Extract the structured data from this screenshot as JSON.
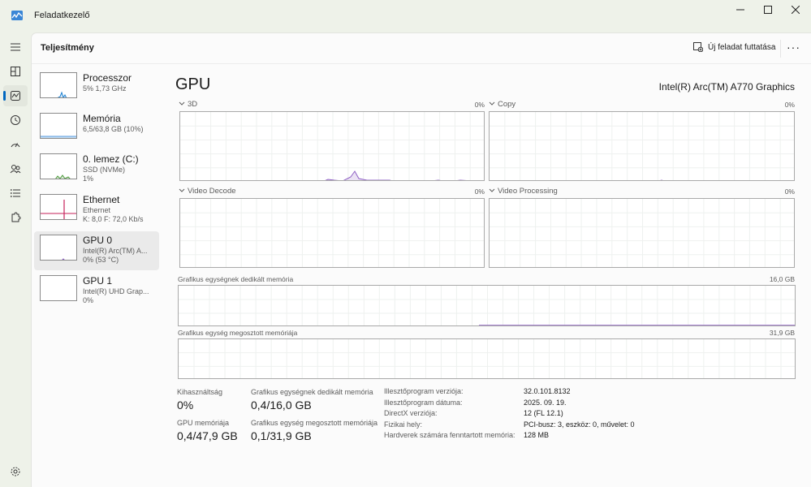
{
  "window": {
    "title": "Feladatkezelő"
  },
  "header": {
    "title": "Teljesítmény",
    "run_new_task": "Új feladat futtatása",
    "more": "···"
  },
  "devices": [
    {
      "name": "Processzor",
      "sub1": "5%  1,73 GHz",
      "sub2": ""
    },
    {
      "name": "Memória",
      "sub1": "6,5/63,8 GB (10%)",
      "sub2": ""
    },
    {
      "name": "0. lemez (C:)",
      "sub1": "SSD (NVMe)",
      "sub2": "1%"
    },
    {
      "name": "Ethernet",
      "sub1": "Ethernet",
      "sub2": "K: 8,0  F: 72,0 Kb/s"
    },
    {
      "name": "GPU 0",
      "sub1": "Intel(R) Arc(TM) A...",
      "sub2": "0%  (53 °C)"
    },
    {
      "name": "GPU 1",
      "sub1": "Intel(R) UHD Grap...",
      "sub2": "0%"
    }
  ],
  "detail": {
    "title": "GPU",
    "model": "Intel(R) Arc(TM) A770 Graphics",
    "engines": [
      {
        "name": "3D",
        "percent": "0%"
      },
      {
        "name": "Copy",
        "percent": "0%"
      },
      {
        "name": "Video Decode",
        "percent": "0%"
      },
      {
        "name": "Video Processing",
        "percent": "0%"
      }
    ],
    "dedicated_memory": {
      "label": "Grafikus egységnek dedikált memória",
      "max": "16,0 GB"
    },
    "shared_memory": {
      "label": "Grafikus egység megosztott memóriája",
      "max": "31,9 GB"
    }
  },
  "stats": {
    "utilization_label": "Kihasználtság",
    "utilization_value": "0%",
    "gpu_memory_label": "GPU memóriája",
    "gpu_memory_value": "0,4/47,9 GB",
    "dedicated_label": "Grafikus egységnek dedikált memória",
    "dedicated_value": "0,4/16,0 GB",
    "shared_label": "Grafikus egység megosztott memóriája",
    "shared_value": "0,1/31,9 GB"
  },
  "info": [
    {
      "key": "Illesztőprogram verziója:",
      "value": "32.0.101.8132"
    },
    {
      "key": "Illesztőprogram dátuma:",
      "value": "2025. 09. 19."
    },
    {
      "key": "DirectX verziója:",
      "value": "12 (FL 12.1)"
    },
    {
      "key": "Fizikai hely:",
      "value": "PCI-busz: 3, eszköz: 0, művelet: 0"
    },
    {
      "key": "Hardverek számára fenntartott memória:",
      "value": "128 MB"
    }
  ],
  "colors": {
    "accent": "#0067c0",
    "cpu": "#1a7fd1",
    "memory": "#5a9ee0",
    "disk": "#4d9a3c",
    "ethernet": "#c6215a",
    "gpu": "#8e5fc4"
  }
}
